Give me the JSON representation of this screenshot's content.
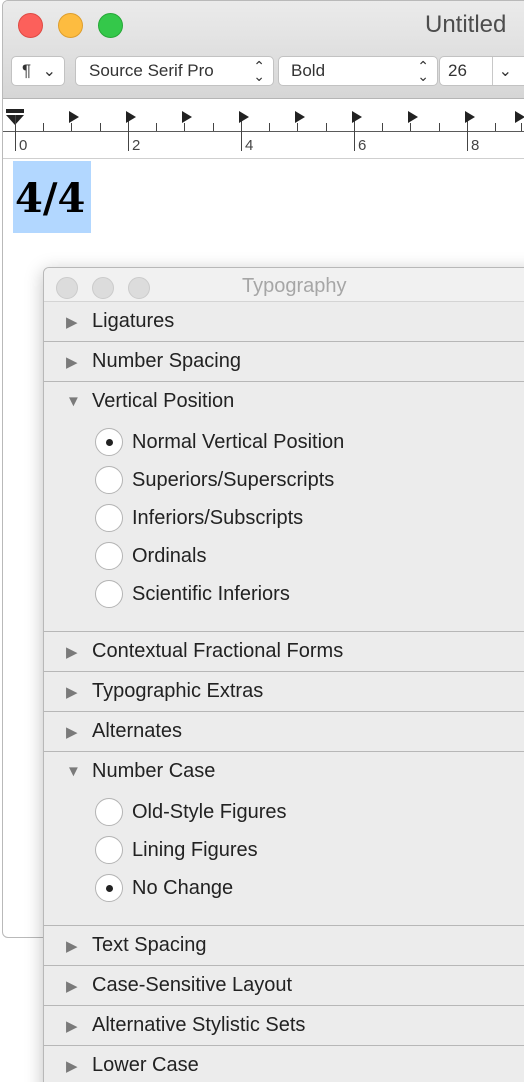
{
  "window": {
    "title": "Untitled",
    "toolbar": {
      "paragraph_symbol": "¶",
      "font_family": "Source Serif Pro",
      "font_style": "Bold",
      "font_size": "26"
    },
    "ruler": {
      "labels": [
        "0",
        "2",
        "4",
        "6",
        "8"
      ]
    },
    "document_text": "4/4"
  },
  "panel": {
    "title": "Typography",
    "sections": [
      {
        "label": "Ligatures",
        "expanded": false
      },
      {
        "label": "Number Spacing",
        "expanded": false
      },
      {
        "label": "Vertical Position",
        "expanded": true,
        "options": [
          {
            "label": "Normal Vertical Position",
            "selected": true
          },
          {
            "label": "Superiors/Superscripts",
            "selected": false
          },
          {
            "label": "Inferiors/Subscripts",
            "selected": false
          },
          {
            "label": "Ordinals",
            "selected": false
          },
          {
            "label": "Scientific Inferiors",
            "selected": false
          }
        ]
      },
      {
        "label": "Contextual Fractional Forms",
        "expanded": false
      },
      {
        "label": "Typographic Extras",
        "expanded": false
      },
      {
        "label": "Alternates",
        "expanded": false
      },
      {
        "label": "Number Case",
        "expanded": true,
        "options": [
          {
            "label": "Old-Style Figures",
            "selected": false
          },
          {
            "label": "Lining Figures",
            "selected": false
          },
          {
            "label": "No Change",
            "selected": true
          }
        ]
      },
      {
        "label": "Text Spacing",
        "expanded": false
      },
      {
        "label": "Case-Sensitive Layout",
        "expanded": false
      },
      {
        "label": "Alternative Stylistic Sets",
        "expanded": false
      },
      {
        "label": "Lower Case",
        "expanded": false
      }
    ]
  },
  "icons": {
    "collapsed": "▶",
    "expanded": "▼",
    "stepper": "⌃⌄",
    "dropdown": "⌄"
  }
}
